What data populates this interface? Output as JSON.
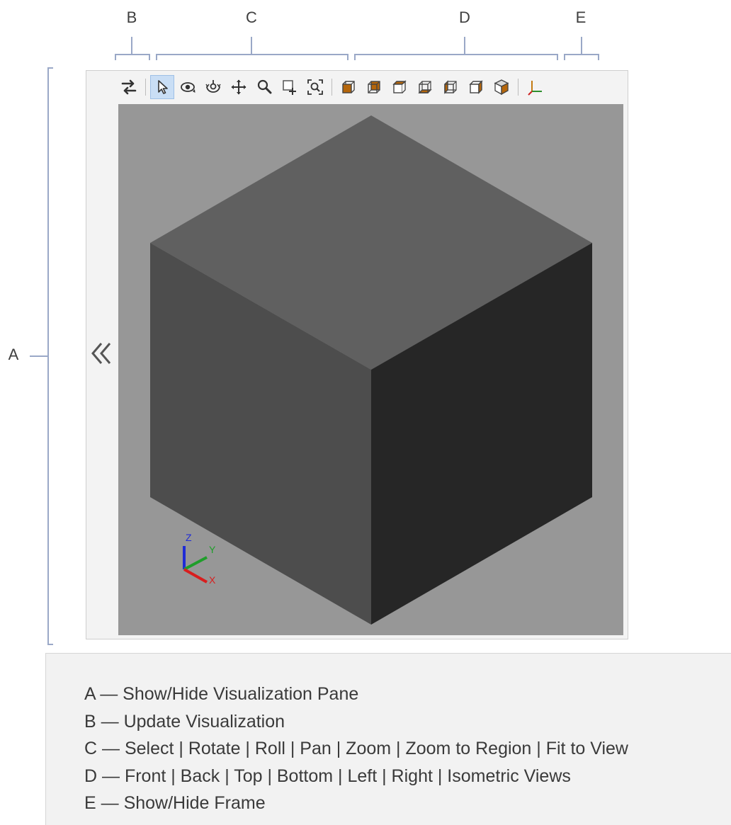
{
  "callouts": {
    "a": "A",
    "b": "B",
    "c": "C",
    "d": "D",
    "e": "E"
  },
  "toolbar": {
    "update_visualization": {
      "icon": "swap-arrows-icon"
    },
    "navigation": [
      {
        "icon": "select-arrow-icon",
        "active": true
      },
      {
        "icon": "rotate-icon"
      },
      {
        "icon": "roll-icon"
      },
      {
        "icon": "pan-icon"
      },
      {
        "icon": "zoom-icon"
      },
      {
        "icon": "zoom-to-region-icon"
      },
      {
        "icon": "fit-to-view-icon"
      }
    ],
    "views": [
      {
        "icon": "front-view-icon"
      },
      {
        "icon": "back-view-icon"
      },
      {
        "icon": "top-view-icon"
      },
      {
        "icon": "bottom-view-icon"
      },
      {
        "icon": "left-view-icon"
      },
      {
        "icon": "right-view-icon"
      },
      {
        "icon": "isometric-view-icon"
      }
    ],
    "frame": {
      "icon": "axes-frame-icon"
    }
  },
  "viewport": {
    "background": "#979797",
    "cube_faces": {
      "top": "#606060",
      "left": "#4d4d4d",
      "right": "#262626"
    },
    "triad": {
      "z": "Z",
      "y": "Y",
      "x": "X"
    },
    "triad_colors": {
      "z": "#1f2bd6",
      "y": "#1f9e2a",
      "x": "#d81e1e"
    }
  },
  "collapse_icon": "double-chevron-left-icon",
  "legend": [
    "A — Show/Hide Visualization Pane",
    "B — Update Visualization",
    "C — Select | Rotate | Roll | Pan | Zoom | Zoom to Region | Fit to View",
    "D — Front | Back | Top | Bottom | Left | Right | Isometric Views",
    "E — Show/Hide Frame"
  ],
  "colors": {
    "bracket": "#9aa8c7",
    "accent_orange": "#b5660b",
    "active_button": "#c9def5"
  }
}
